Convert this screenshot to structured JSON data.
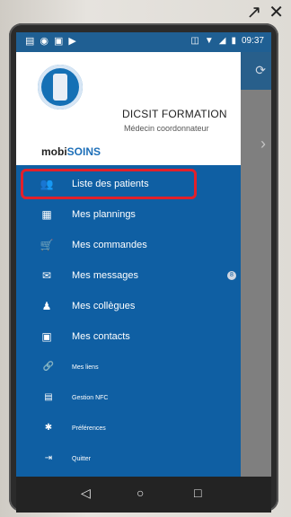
{
  "status_bar": {
    "time": "09:37",
    "left_icons": [
      "notification-icon",
      "eye-icon",
      "screen-icon",
      "play-icon"
    ],
    "right_icons": [
      "nfc-icon",
      "wifi-icon",
      "signal-icon",
      "battery-icon"
    ]
  },
  "outer_controls": {
    "external_glyph": "↗",
    "close_glyph": "✕"
  },
  "drawer": {
    "header": {
      "title": "DICSIT FORMATION",
      "subtitle": "Médecin coordonnateur",
      "logo_prefix": "mobi",
      "logo_suffix": "SOINS"
    },
    "items": [
      {
        "label": "Liste des patients",
        "icon": "users-icon",
        "glyph": "👥",
        "highlighted": true
      },
      {
        "label": "Mes plannings",
        "icon": "calendar-icon",
        "glyph": "▦"
      },
      {
        "label": "Mes commandes",
        "icon": "cart-icon",
        "glyph": "🛒"
      },
      {
        "label": "Mes messages",
        "icon": "mail-icon",
        "glyph": "✉",
        "badge": "8"
      },
      {
        "label": "Mes collègues",
        "icon": "colleagues-icon",
        "glyph": "♟"
      },
      {
        "label": "Mes contacts",
        "icon": "building-icon",
        "glyph": "▣"
      },
      {
        "label": "Mes liens",
        "icon": "link-icon",
        "glyph": "🔗"
      },
      {
        "label": "Gestion NFC",
        "icon": "nfc-icon",
        "glyph": "▤"
      },
      {
        "label": "Préférences",
        "icon": "gear-icon",
        "glyph": "✱"
      },
      {
        "label": "Quitter",
        "icon": "exit-icon",
        "glyph": "⇥"
      }
    ]
  },
  "background_app": {
    "refresh_glyph": "⟳",
    "arrow_glyph": "›"
  },
  "nav_bar": {
    "back": "◁",
    "home": "○",
    "recent": "□"
  }
}
